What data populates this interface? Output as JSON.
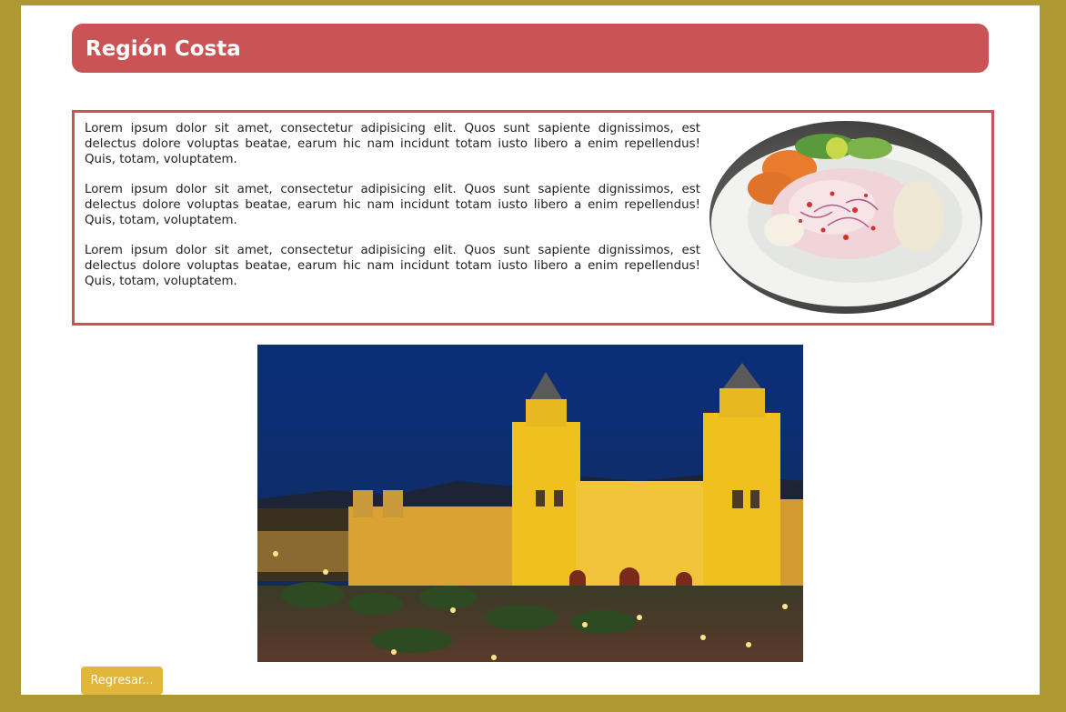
{
  "header": {
    "title": "Región Costa"
  },
  "content": {
    "paragraphs": [
      "Lorem ipsum dolor sit amet, consectetur adipisicing elit. Quos sunt sapiente dignissimos, est delectus dolore voluptas beatae, earum hic nam incidunt totam iusto libero a enim repellendus! Quis, totam, voluptatem.",
      "Lorem ipsum dolor sit amet, consectetur adipisicing elit. Quos sunt sapiente dignissimos, est delectus dolore voluptas beatae, earum hic nam incidunt totam iusto libero a enim repellendus! Quis, totam, voluptatem.",
      "Lorem ipsum dolor sit amet, consectetur adipisicing elit. Quos sunt sapiente dignissimos, est delectus dolore voluptas beatae, earum hic nam incidunt totam iusto libero a enim repellendus! Quis, totam, voluptatem."
    ]
  },
  "images": {
    "dish": "ceviche-plate-photo",
    "city": "cathedral-night-photo"
  },
  "footer": {
    "back_label": "Regresar..."
  },
  "colors": {
    "frame": "#ad9831",
    "header_bg": "#c95355",
    "box_border": "#c95355",
    "button_bg": "#e1b63a"
  }
}
